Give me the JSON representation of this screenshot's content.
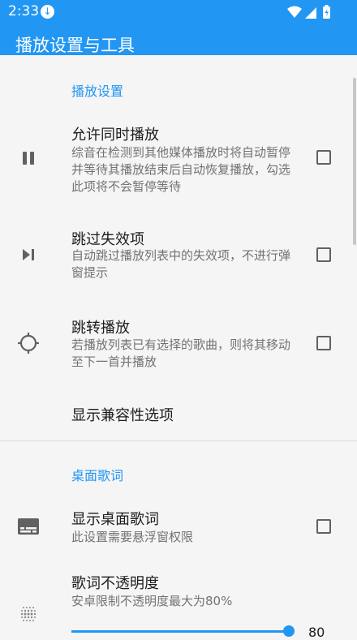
{
  "status_bar": {
    "time": "2:33"
  },
  "app_bar": {
    "title": "播放设置与工具"
  },
  "playback_section": {
    "header": "播放设置",
    "items": [
      {
        "title": "允许同时播放",
        "summary": "综音在检测到其他媒体播放时将自动暂停并等待其播放结束后自动恢复播放，勾选此项将不会暂停等待",
        "icon": "pause-icon",
        "checked": false
      },
      {
        "title": "跳过失效项",
        "summary": "自动跳过播放列表中的失效项，不进行弹窗提示",
        "icon": "skip-next-icon",
        "checked": false
      },
      {
        "title": "跳转播放",
        "summary": "若播放列表已有选择的歌曲，则将其移动至下一首并播放",
        "icon": "crosshair-icon",
        "checked": false
      }
    ],
    "compat_option": "显示兼容性选项"
  },
  "lyrics_section": {
    "header": "桌面歌词",
    "show_lyrics": {
      "title": "显示桌面歌词",
      "summary": "此设置需要悬浮窗权限",
      "icon": "subtitles-icon",
      "checked": false
    },
    "opacity": {
      "title": "歌词不透明度",
      "summary": "安卓限制不透明度最大为80%",
      "icon": "opacity-icon",
      "value": "80",
      "max": 80
    }
  },
  "colors": {
    "accent": "#2196f3",
    "background": "#f5f5f6"
  }
}
